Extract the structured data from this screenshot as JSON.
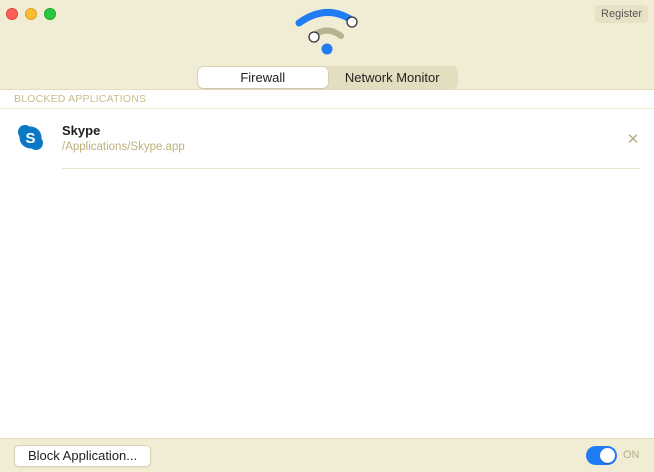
{
  "titlebar": {
    "register_label": "Register",
    "logo_icon": "wifi-firewall-logo-icon"
  },
  "tabs": [
    {
      "label": "Firewall",
      "active": true
    },
    {
      "label": "Network Monitor",
      "active": false
    }
  ],
  "blocked": {
    "section_title": "BLOCKED APPLICATIONS",
    "items": [
      {
        "name": "Skype",
        "path": "/Applications/Skype.app",
        "icon": "skype-icon"
      }
    ]
  },
  "footer": {
    "block_button_label": "Block Application...",
    "toggle_state_label": "ON",
    "toggle_on": true
  },
  "colors": {
    "accent": "#1f7cf2",
    "chrome_bg": "#f1ecd4",
    "muted_text": "#bdb07a"
  }
}
